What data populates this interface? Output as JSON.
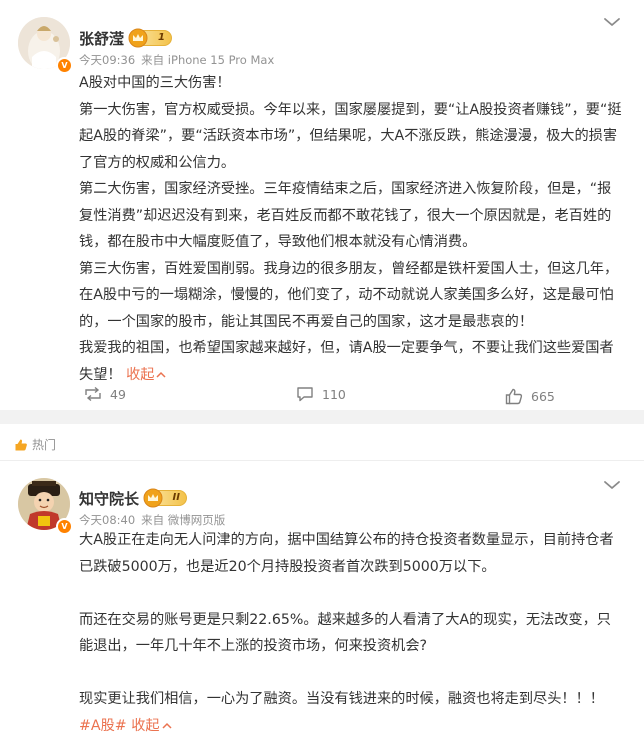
{
  "post1": {
    "author": "张舒滢",
    "level": "1",
    "time": "今天09:36",
    "source": "来自 iPhone 15 Pro Max",
    "paragraphs": [
      "A股对中国的三大伤害！",
      "第一大伤害，官方权威受损。今年以来，国家屡屡提到，要“让A股投资者赚钱”，要“挺起A股的脊梁”，要“活跃资本市场”，但结果呢，大A不涨反跌，熊途漫漫，极大的损害了官方的权威和公信力。",
      "第二大伤害，国家经济受挫。三年疫情结束之后，国家经济进入恢复阶段，但是，“报复性消费”却迟迟没有到来，老百姓反而都不敢花钱了，很大一个原因就是，老百姓的钱，都在股市中大幅度贬值了，导致他们根本就没有心情消费。",
      "第三大伤害，百姓爱国削弱。我身边的很多朋友，曾经都是铁杆爱国人士，但这几年，在A股中亏的一塌糊涂，慢慢的，他们变了，动不动就说人家美国多么好，这是最可怕的，一个国家的股市，能让其国民不再爱自己的国家，这才是最悲哀的！"
    ],
    "last_paragraph": "我爱我的祖国，也希望国家越来越好，但，请A股一定要争气，不要让我们这些爱国者失望！",
    "collapse_label": "收起",
    "reposts": "49",
    "comments": "110",
    "likes": "665"
  },
  "hot_label": "热门",
  "post2": {
    "author": "知守院长",
    "level": "II",
    "time": "今天08:40",
    "source": "来自 微博网页版",
    "p1": "大A股正在走向无人问津的方向，据中国结算公布的持仓投资者数量显示，目前持仓者已跌破5000万，也是近20个月持股投资者首次跌到5000万以下。",
    "p2": "而还在交易的账号更是只剩22.65%。越来越多的人看清了大A的现实，无法改变，只能退出，一年几十年不上涨的投资市场，何来投资机会?",
    "p3": "现实更让我们相信，一心为了融资。当没有钱进来的时候，融资也将走到尽头！！！",
    "hashtag": "#A股#",
    "collapse_label": "收起"
  },
  "colors": {
    "accent": "#eb7350",
    "vip_orange": "#ff8200",
    "meta_gray": "#939393"
  }
}
